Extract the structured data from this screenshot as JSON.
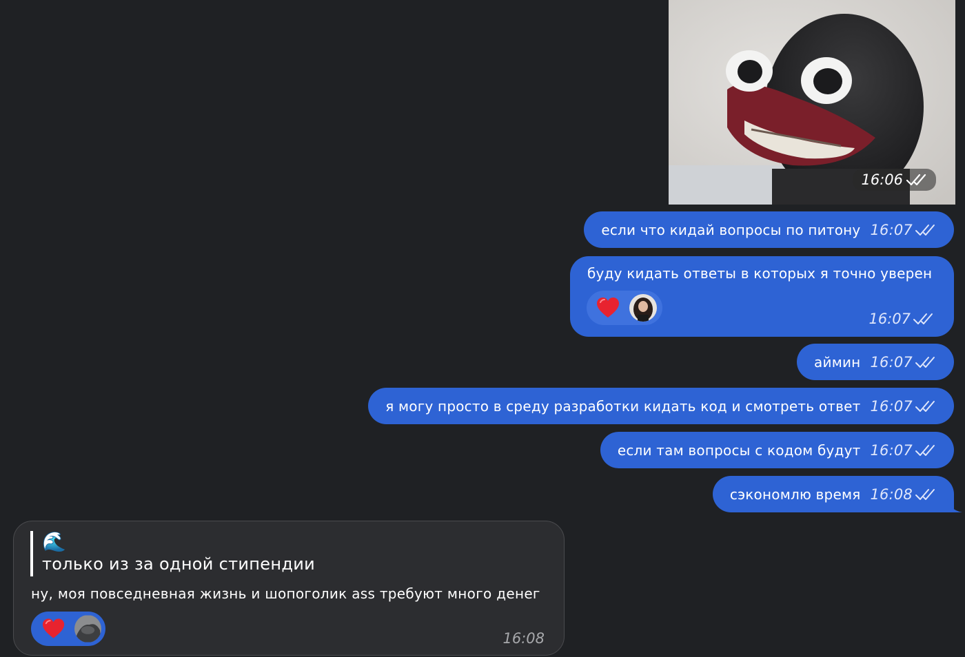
{
  "photo_message": {
    "time": "16:06"
  },
  "messages": [
    {
      "text": "если что кидай вопросы по питону",
      "time": "16:07"
    },
    {
      "text": "буду кидать ответы в которых я точно уверен",
      "time": "16:07"
    },
    {
      "text": "аймин",
      "time": "16:07"
    },
    {
      "text": "я могу просто в среду разработки кидать код и смотреть ответ",
      "time": "16:07"
    },
    {
      "text": "если там вопросы с кодом будут",
      "time": "16:07"
    },
    {
      "text": "сэкономлю время",
      "time": "16:08"
    }
  ],
  "incoming": {
    "quote_emoji": "🌊",
    "quote_text": "только из за одной стипендии",
    "text": "ну, моя повседневная жизнь и шопоголик ass требуют много денег",
    "time": "16:08"
  },
  "colors": {
    "outgoing_bubble": "#2e63d4",
    "incoming_bubble": "#2c2d30",
    "background": "#1f2124"
  }
}
